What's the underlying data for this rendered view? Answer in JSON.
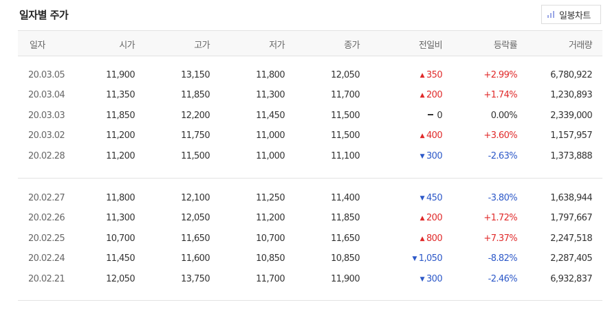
{
  "title": "일자별 주가",
  "chart_button": {
    "label": "일봉차트",
    "icon": "bar-chart-icon"
  },
  "headers": [
    "일자",
    "시가",
    "고가",
    "저가",
    "종가",
    "전일비",
    "등락률",
    "거래량"
  ],
  "colors": {
    "up": "#e02a2a",
    "down": "#2c58c8"
  },
  "groups": [
    [
      {
        "date": "20.03.05",
        "open": "11,900",
        "high": "13,150",
        "low": "11,800",
        "close": "12,050",
        "dir": "up",
        "change": "350",
        "rate": "+2.99%",
        "volume": "6,780,922"
      },
      {
        "date": "20.03.04",
        "open": "11,350",
        "high": "11,850",
        "low": "11,300",
        "close": "11,700",
        "dir": "up",
        "change": "200",
        "rate": "+1.74%",
        "volume": "1,230,893"
      },
      {
        "date": "20.03.03",
        "open": "11,850",
        "high": "12,200",
        "low": "11,450",
        "close": "11,500",
        "dir": "flat",
        "change": "0",
        "rate": "0.00%",
        "volume": "2,339,000"
      },
      {
        "date": "20.03.02",
        "open": "11,200",
        "high": "11,750",
        "low": "11,000",
        "close": "11,500",
        "dir": "up",
        "change": "400",
        "rate": "+3.60%",
        "volume": "1,157,957"
      },
      {
        "date": "20.02.28",
        "open": "11,200",
        "high": "11,500",
        "low": "11,000",
        "close": "11,100",
        "dir": "down",
        "change": "300",
        "rate": "-2.63%",
        "volume": "1,373,888"
      }
    ],
    [
      {
        "date": "20.02.27",
        "open": "11,800",
        "high": "12,100",
        "low": "11,250",
        "close": "11,400",
        "dir": "down",
        "change": "450",
        "rate": "-3.80%",
        "volume": "1,638,944"
      },
      {
        "date": "20.02.26",
        "open": "11,300",
        "high": "12,050",
        "low": "11,200",
        "close": "11,850",
        "dir": "up",
        "change": "200",
        "rate": "+1.72%",
        "volume": "1,797,667"
      },
      {
        "date": "20.02.25",
        "open": "10,700",
        "high": "11,650",
        "low": "10,700",
        "close": "11,650",
        "dir": "up",
        "change": "800",
        "rate": "+7.37%",
        "volume": "2,247,518"
      },
      {
        "date": "20.02.24",
        "open": "11,450",
        "high": "11,600",
        "low": "10,850",
        "close": "10,850",
        "dir": "down",
        "change": "1,050",
        "rate": "-8.82%",
        "volume": "2,287,405"
      },
      {
        "date": "20.02.21",
        "open": "12,050",
        "high": "13,750",
        "low": "11,700",
        "close": "11,900",
        "dir": "down",
        "change": "300",
        "rate": "-2.46%",
        "volume": "6,932,837"
      }
    ]
  ]
}
